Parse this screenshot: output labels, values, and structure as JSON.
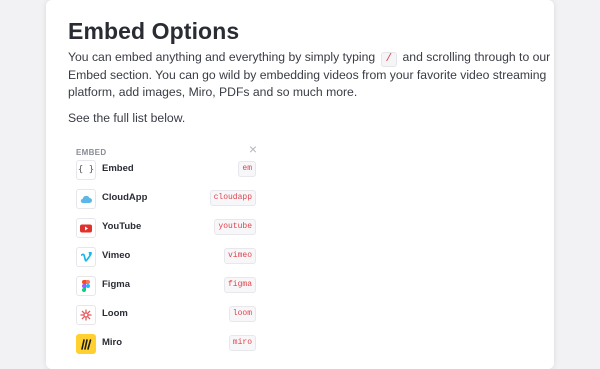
{
  "page": {
    "title": "Embed Options",
    "intro_lines": [
      [
        "You can embed anything and everything by simply typing ",
        "/",
        " and scrolling through to our"
      ],
      "Embed section. You can go wild by embedding videos from your favorite video streaming",
      "platform, add images, Miro, PDFs and so much more."
    ],
    "see_below": "See the full list below."
  },
  "menu": {
    "header": "EMBED",
    "close_icon": "close-icon",
    "items": [
      {
        "label": "Embed",
        "code": "em",
        "icon": "braces-icon",
        "color": "#555555"
      },
      {
        "label": "CloudApp",
        "code": "cloudapp",
        "icon": "cloudapp-icon",
        "color": "#5bb8e6"
      },
      {
        "label": "YouTube",
        "code": "youtube",
        "icon": "youtube-icon",
        "color": "#e0312c"
      },
      {
        "label": "Vimeo",
        "code": "vimeo",
        "icon": "vimeo-icon",
        "color": "#1ab7ea"
      },
      {
        "label": "Figma",
        "code": "figma",
        "icon": "figma-icon",
        "color": "#f24e1e"
      },
      {
        "label": "Loom",
        "code": "loom",
        "icon": "loom-icon",
        "color": "#e8575f"
      },
      {
        "label": "Miro",
        "code": "miro",
        "icon": "miro-icon",
        "color": "#ffd02f"
      }
    ]
  }
}
